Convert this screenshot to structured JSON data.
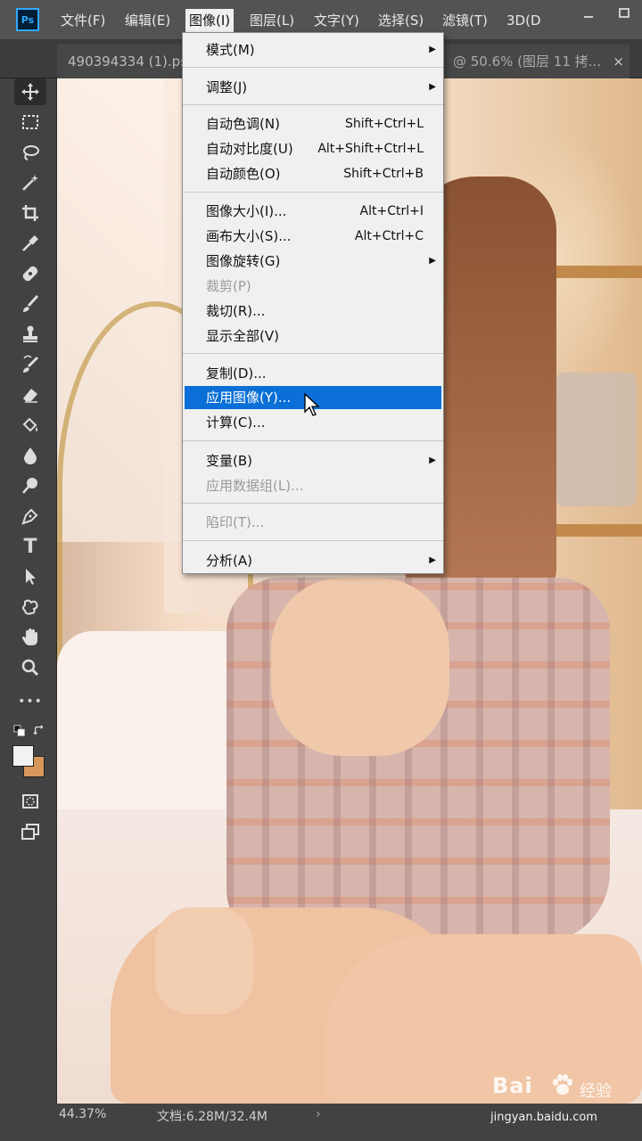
{
  "app": {
    "logo_text": "Ps",
    "accent_color": "#31a8ff"
  },
  "menubar": {
    "items": [
      "文件(F)",
      "编辑(E)",
      "图像(I)",
      "图层(L)",
      "文字(Y)",
      "选择(S)",
      "滤镜(T)",
      "3D(D"
    ],
    "active": "图像(I)",
    "window_controls": [
      "minimize-icon",
      "maximize-icon"
    ]
  },
  "tabs": {
    "left": "490394334 (1).ps",
    "right": "@ 50.6% (图层 11 拷...",
    "close": "×"
  },
  "toolbar": {
    "collapse": "»",
    "tools": [
      "move-icon",
      "marquee-icon",
      "lasso-icon",
      "magic-wand-icon",
      "crop-icon",
      "eyedropper-icon",
      "healing-brush-icon",
      "brush-icon",
      "clone-stamp-icon",
      "history-brush-icon",
      "eraser-icon",
      "paint-bucket-icon",
      "blur-icon",
      "dodge-icon",
      "pen-icon",
      "type-icon",
      "path-selection-icon",
      "shape-icon",
      "hand-icon",
      "zoom-icon",
      "more-tools-icon",
      "default-colors-icon",
      "swap-colors-icon",
      "color-swatches-icon",
      "quick-mask-icon",
      "screen-mode-icon"
    ],
    "type_tool_label": "T",
    "more_label": "•••",
    "foreground_color": "#f2f2f2",
    "background_color": "#d8975a"
  },
  "dropdown": {
    "groups": [
      [
        {
          "label": "模式(M)",
          "shortcut": "",
          "submenu": true,
          "disabled": false
        }
      ],
      [
        {
          "label": "调整(J)",
          "shortcut": "",
          "submenu": true,
          "disabled": false
        }
      ],
      [
        {
          "label": "自动色调(N)",
          "shortcut": "Shift+Ctrl+L",
          "submenu": false,
          "disabled": false
        },
        {
          "label": "自动对比度(U)",
          "shortcut": "Alt+Shift+Ctrl+L",
          "submenu": false,
          "disabled": false
        },
        {
          "label": "自动颜色(O)",
          "shortcut": "Shift+Ctrl+B",
          "submenu": false,
          "disabled": false
        }
      ],
      [
        {
          "label": "图像大小(I)...",
          "shortcut": "Alt+Ctrl+I",
          "submenu": false,
          "disabled": false
        },
        {
          "label": "画布大小(S)...",
          "shortcut": "Alt+Ctrl+C",
          "submenu": false,
          "disabled": false
        },
        {
          "label": "图像旋转(G)",
          "shortcut": "",
          "submenu": true,
          "disabled": false
        },
        {
          "label": "裁剪(P)",
          "shortcut": "",
          "submenu": false,
          "disabled": true
        },
        {
          "label": "裁切(R)...",
          "shortcut": "",
          "submenu": false,
          "disabled": false
        },
        {
          "label": "显示全部(V)",
          "shortcut": "",
          "submenu": false,
          "disabled": false
        }
      ],
      [
        {
          "label": "复制(D)...",
          "shortcut": "",
          "submenu": false,
          "disabled": false
        },
        {
          "label": "应用图像(Y)...",
          "shortcut": "",
          "submenu": false,
          "disabled": false,
          "highlighted": true
        },
        {
          "label": "计算(C)...",
          "shortcut": "",
          "submenu": false,
          "disabled": false
        }
      ],
      [
        {
          "label": "变量(B)",
          "shortcut": "",
          "submenu": true,
          "disabled": false
        },
        {
          "label": "应用数据组(L)...",
          "shortcut": "",
          "submenu": false,
          "disabled": true
        }
      ],
      [
        {
          "label": "陷印(T)...",
          "shortcut": "",
          "submenu": false,
          "disabled": true
        }
      ],
      [
        {
          "label": "分析(A)",
          "shortcut": "",
          "submenu": true,
          "disabled": false
        }
      ]
    ],
    "highlight_color": "#0a6fd6",
    "submenu_arrow": "▶"
  },
  "statusbar": {
    "zoom": "44.37%",
    "doc_info": "文档:6.28M/32.4M",
    "arrow": "›"
  },
  "watermark": {
    "logo": "Bai",
    "logo_suffix": "经验",
    "url": "jingyan.baidu.com"
  }
}
